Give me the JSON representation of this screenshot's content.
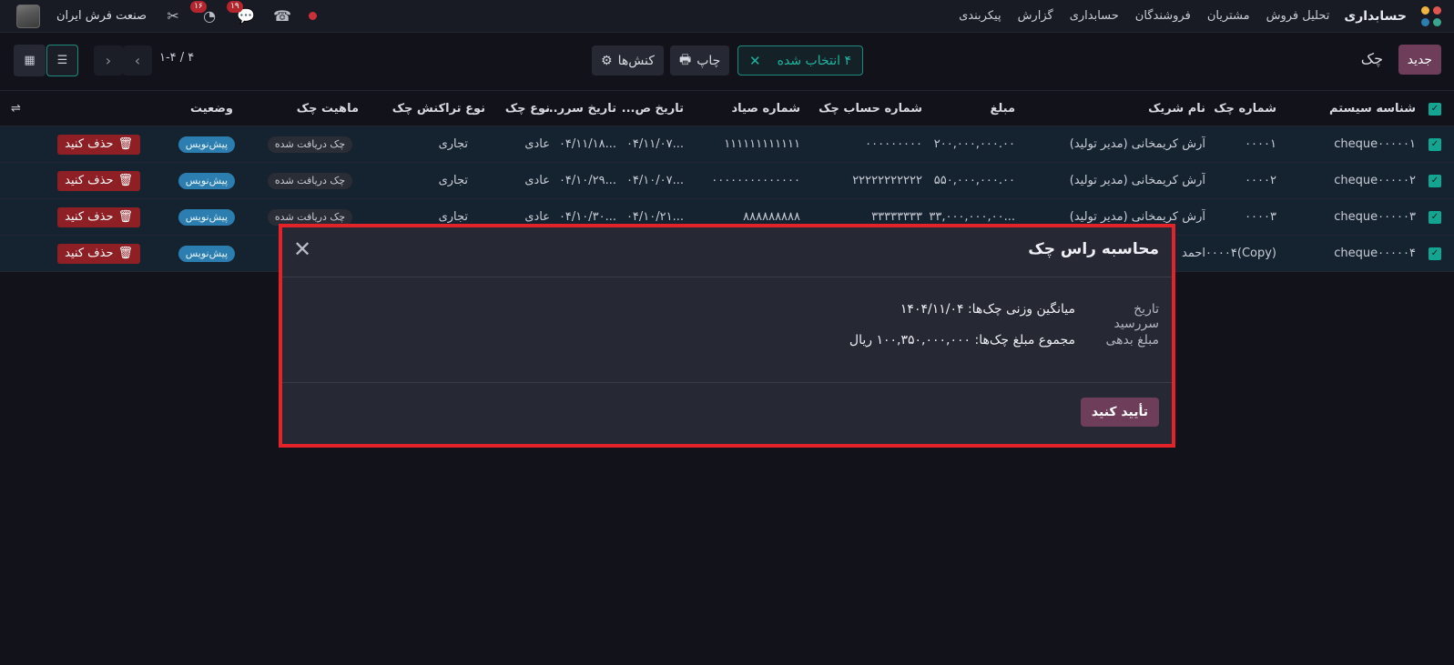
{
  "navbar": {
    "app_title": "حسابداری",
    "menu": [
      "تحلیل فروش",
      "مشتریان",
      "فروشندگان",
      "حسابداری",
      "گزارش",
      "پیکربندی"
    ],
    "company": "صنعت فرش ایران",
    "activity_count": "۱۶",
    "messages_count": "۱۹"
  },
  "control": {
    "new_label": "جدید",
    "breadcrumb": "چک",
    "selected_label": "۴ انتخاب شده",
    "print_label": "چاپ",
    "actions_label": "کنش‌ها",
    "pager": "۱-۴ / ۴"
  },
  "table": {
    "headers": [
      "شناسه سیستم",
      "شماره چک",
      "نام شریک",
      "مبلغ",
      "شماره حساب چک",
      "شماره صیاد",
      "تاریخ ص...",
      "تاریخ سرر...",
      "نوع چک",
      "نوع تراکنش چک",
      "ماهیت چک",
      "وضعیت"
    ],
    "rows": [
      {
        "sys": "cheque۰۰۰۰۰۱",
        "num": "۰۰۰۰۱",
        "partner": "آرش کریمخانی (مدیر تولید)",
        "amount": "۲۰۰,۰۰۰,۰۰۰.۰۰",
        "account": "۰۰۰۰۰۰۰۰۰",
        "sayad": "۱۱۱۱۱۱۱۱۱۱۱۱",
        "issue": "...۰۴/۱۱/۰۷",
        "due": "...۰۴/۱۱/۱۸",
        "type": "عادی",
        "trans": "تجاری",
        "nature": "چک دریافت شده",
        "status": "پیش‌نویس",
        "delete": "حذف کنید"
      },
      {
        "sys": "cheque۰۰۰۰۰۲",
        "num": "۰۰۰۰۲",
        "partner": "آرش کریمخانی (مدیر تولید)",
        "amount": "۵۵۰,۰۰۰,۰۰۰.۰۰",
        "account": "۲۲۲۲۲۲۲۲۲۲۲",
        "sayad": "۰۰۰۰۰۰۰۰۰۰۰۰۰۰",
        "issue": "...۰۴/۱۰/۰۷",
        "due": "...۰۴/۱۰/۲۹",
        "type": "عادی",
        "trans": "تجاری",
        "nature": "چک دریافت شده",
        "status": "پیش‌نویس",
        "delete": "حذف کنید"
      },
      {
        "sys": "cheque۰۰۰۰۰۳",
        "num": "۰۰۰۰۳",
        "partner": "آرش کریمخانی (مدیر تولید)",
        "amount": "...۳۳,۰۰۰,۰۰۰,۰۰",
        "account": "۳۳۳۳۳۳۳۳",
        "sayad": "۸۸۸۸۸۸۸۸۸",
        "issue": "...۰۴/۱۰/۲۱",
        "due": "...۰۴/۱۰/۳۰",
        "type": "عادی",
        "trans": "تجاری",
        "nature": "چک دریافت شده",
        "status": "پیش‌نویس",
        "delete": "حذف کنید"
      },
      {
        "sys": "cheque۰۰۰۰۰۴",
        "num": "(Copy)۰۰۰۰۴",
        "partner": "احمد",
        "amount": "",
        "account": "",
        "sayad": "",
        "issue": "",
        "due": "",
        "type": "",
        "trans": "",
        "nature": "",
        "status": "پیش‌نویس",
        "delete": "حذف کنید"
      }
    ]
  },
  "modal": {
    "title": "محاسبه راس چک",
    "due_label": "تاریخ سررسید",
    "due_value": "میانگین وزنی چک‌ها: ۱۴۰۴/۱۱/۰۴",
    "amount_label": "مبلغ بدهی",
    "amount_value": "مجموع مبلغ چک‌ها: ۱۰۰,۳۵۰,۰۰۰,۰۰۰ ریال",
    "confirm_label": "تأیید کنید"
  },
  "colors": {
    "accent": "#6e3d5a",
    "teal": "#13a591",
    "danger": "#8e1f24",
    "highlight": "#e3232a"
  }
}
